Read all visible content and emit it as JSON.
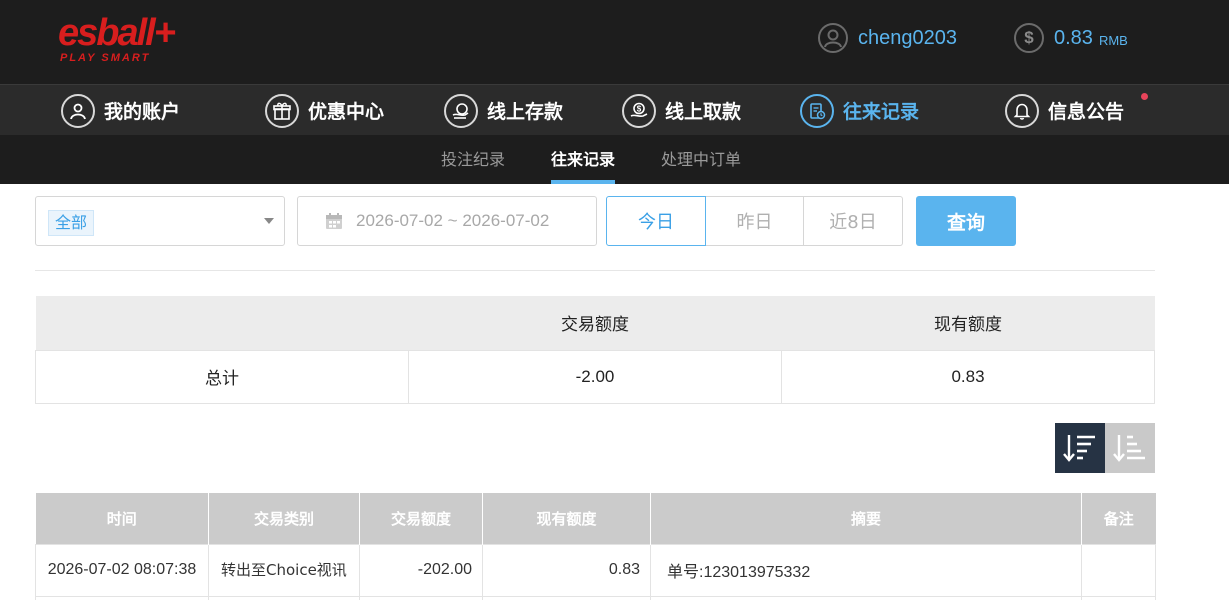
{
  "header": {
    "logo_text": "esball+",
    "logo_tagline": "PLAY SMART",
    "username": "cheng0203",
    "balance": "0.83",
    "currency": "RMB",
    "balance_icon": "$"
  },
  "main_nav": {
    "items": [
      {
        "label": "我的账户",
        "icon": "user-icon"
      },
      {
        "label": "优惠中心",
        "icon": "gift-icon"
      },
      {
        "label": "线上存款",
        "icon": "deposit-icon"
      },
      {
        "label": "线上取款",
        "icon": "withdraw-icon"
      },
      {
        "label": "往来记录",
        "icon": "records-icon",
        "active": true
      },
      {
        "label": "信息公告",
        "icon": "bell-icon",
        "has_notification": true
      }
    ]
  },
  "sub_nav": {
    "tabs": [
      {
        "label": "投注纪录"
      },
      {
        "label": "往来记录",
        "active": true
      },
      {
        "label": "处理中订单"
      }
    ]
  },
  "filters": {
    "type_selected": "全部",
    "date_range": "2026-07-02 ~ 2026-07-02",
    "quick_ranges": [
      "今日",
      "昨日",
      "近8日"
    ],
    "active_range": "今日",
    "query_label": "查询"
  },
  "summary": {
    "headers": [
      "",
      "交易额度",
      "现有额度"
    ],
    "row": {
      "label": "总计",
      "amount": "-2.00",
      "balance": "0.83"
    }
  },
  "records": {
    "headers": [
      "时间",
      "交易类别",
      "交易额度",
      "现有额度",
      "摘要",
      "备注"
    ],
    "rows": [
      {
        "time": "2026-07-02 08:07:38",
        "type": "转出至Choice视讯",
        "amount": "-202.00",
        "balance": "0.83",
        "summary": "单号:123013975332",
        "note": ""
      }
    ]
  },
  "colors": {
    "accent": "#5ab4ee",
    "header_bg": "#1d1d1d",
    "nav_bg": "#2b2b2b",
    "logo_red": "#d81e1e",
    "sort_active": "#263344"
  }
}
